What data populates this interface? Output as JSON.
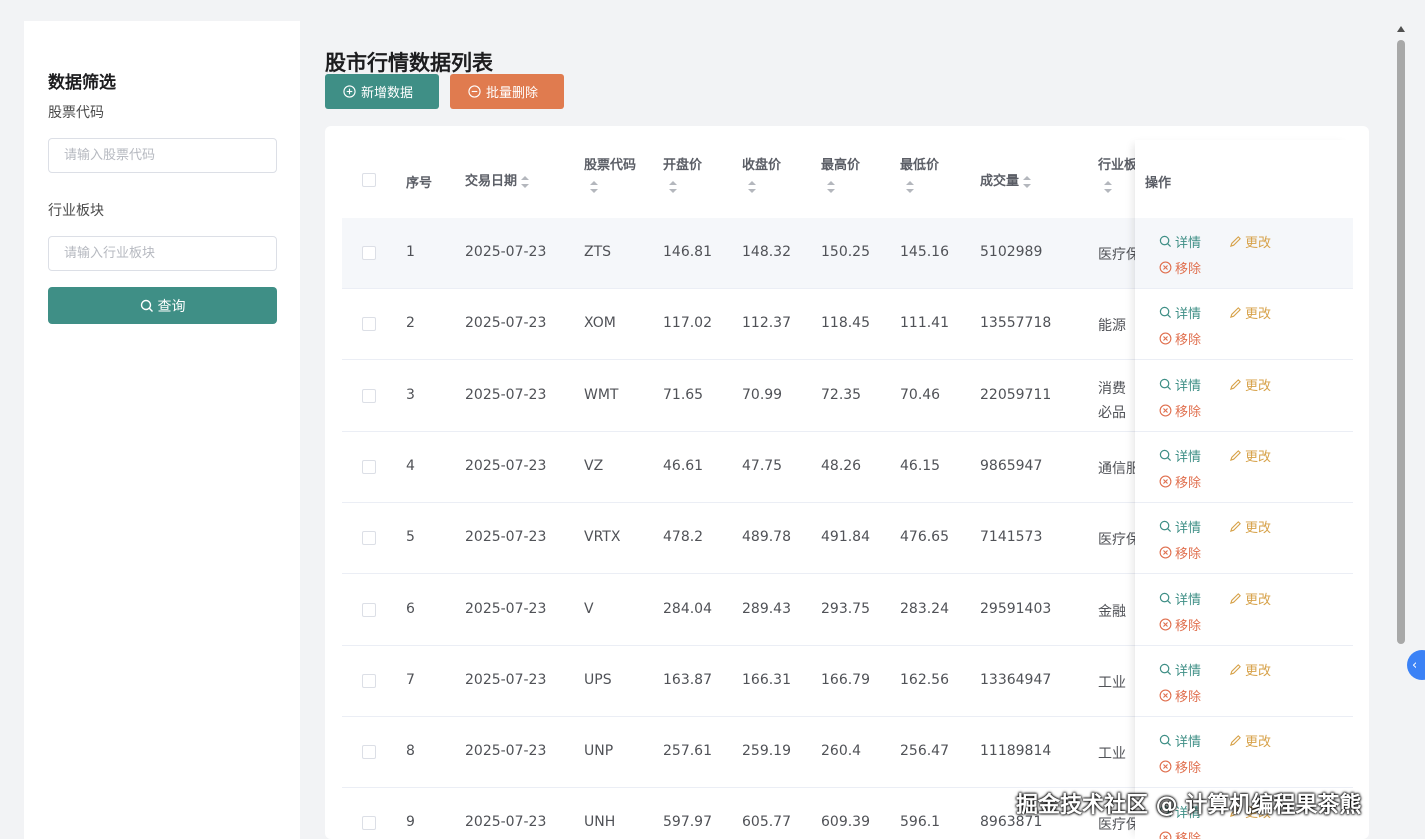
{
  "sidebar": {
    "title": "数据筛选",
    "stock_code_label": "股票代码",
    "stock_code_placeholder": "请输入股票代码",
    "industry_label": "行业板块",
    "industry_placeholder": "请输入行业板块",
    "query_label": "查询"
  },
  "main": {
    "title": "股市行情数据列表",
    "add_label": "新增数据",
    "batch_delete_label": "批量删除"
  },
  "table": {
    "headers": {
      "index": "序号",
      "date": "交易日期",
      "code": "股票代码",
      "open": "开盘价",
      "close": "收盘价",
      "high": "最高价",
      "low": "最低价",
      "volume": "成交量",
      "industry": "行业板",
      "ops": "操作"
    },
    "ops_labels": {
      "detail": "详情",
      "edit": "更改",
      "remove": "移除"
    },
    "rows": [
      {
        "index": "1",
        "date": "2025-07-23",
        "code": "ZTS",
        "open": "146.81",
        "close": "148.32",
        "high": "150.25",
        "low": "145.16",
        "volume": "5102989",
        "industry": "医疗保"
      },
      {
        "index": "2",
        "date": "2025-07-23",
        "code": "XOM",
        "open": "117.02",
        "close": "112.37",
        "high": "118.45",
        "low": "111.41",
        "volume": "13557718",
        "industry": "能源"
      },
      {
        "index": "3",
        "date": "2025-07-23",
        "code": "WMT",
        "open": "71.65",
        "close": "70.99",
        "high": "72.35",
        "low": "70.46",
        "volume": "22059711",
        "industry": "消费必品"
      },
      {
        "index": "4",
        "date": "2025-07-23",
        "code": "VZ",
        "open": "46.61",
        "close": "47.75",
        "high": "48.26",
        "low": "46.15",
        "volume": "9865947",
        "industry": "通信服"
      },
      {
        "index": "5",
        "date": "2025-07-23",
        "code": "VRTX",
        "open": "478.2",
        "close": "489.78",
        "high": "491.84",
        "low": "476.65",
        "volume": "7141573",
        "industry": "医疗保"
      },
      {
        "index": "6",
        "date": "2025-07-23",
        "code": "V",
        "open": "284.04",
        "close": "289.43",
        "high": "293.75",
        "low": "283.24",
        "volume": "29591403",
        "industry": "金融"
      },
      {
        "index": "7",
        "date": "2025-07-23",
        "code": "UPS",
        "open": "163.87",
        "close": "166.31",
        "high": "166.79",
        "low": "162.56",
        "volume": "13364947",
        "industry": "工业"
      },
      {
        "index": "8",
        "date": "2025-07-23",
        "code": "UNP",
        "open": "257.61",
        "close": "259.19",
        "high": "260.4",
        "low": "256.47",
        "volume": "11189814",
        "industry": "工业"
      },
      {
        "index": "9",
        "date": "2025-07-23",
        "code": "UNH",
        "open": "597.97",
        "close": "605.77",
        "high": "609.39",
        "low": "596.1",
        "volume": "8963871",
        "industry": "医疗保"
      }
    ]
  },
  "watermark": "掘金技术社区 @ 计算机编程果茶熊",
  "colors": {
    "primary": "#3f8f86",
    "danger_button": "#e07b4f",
    "edit": "#d7a24a",
    "remove": "#e0704f"
  }
}
